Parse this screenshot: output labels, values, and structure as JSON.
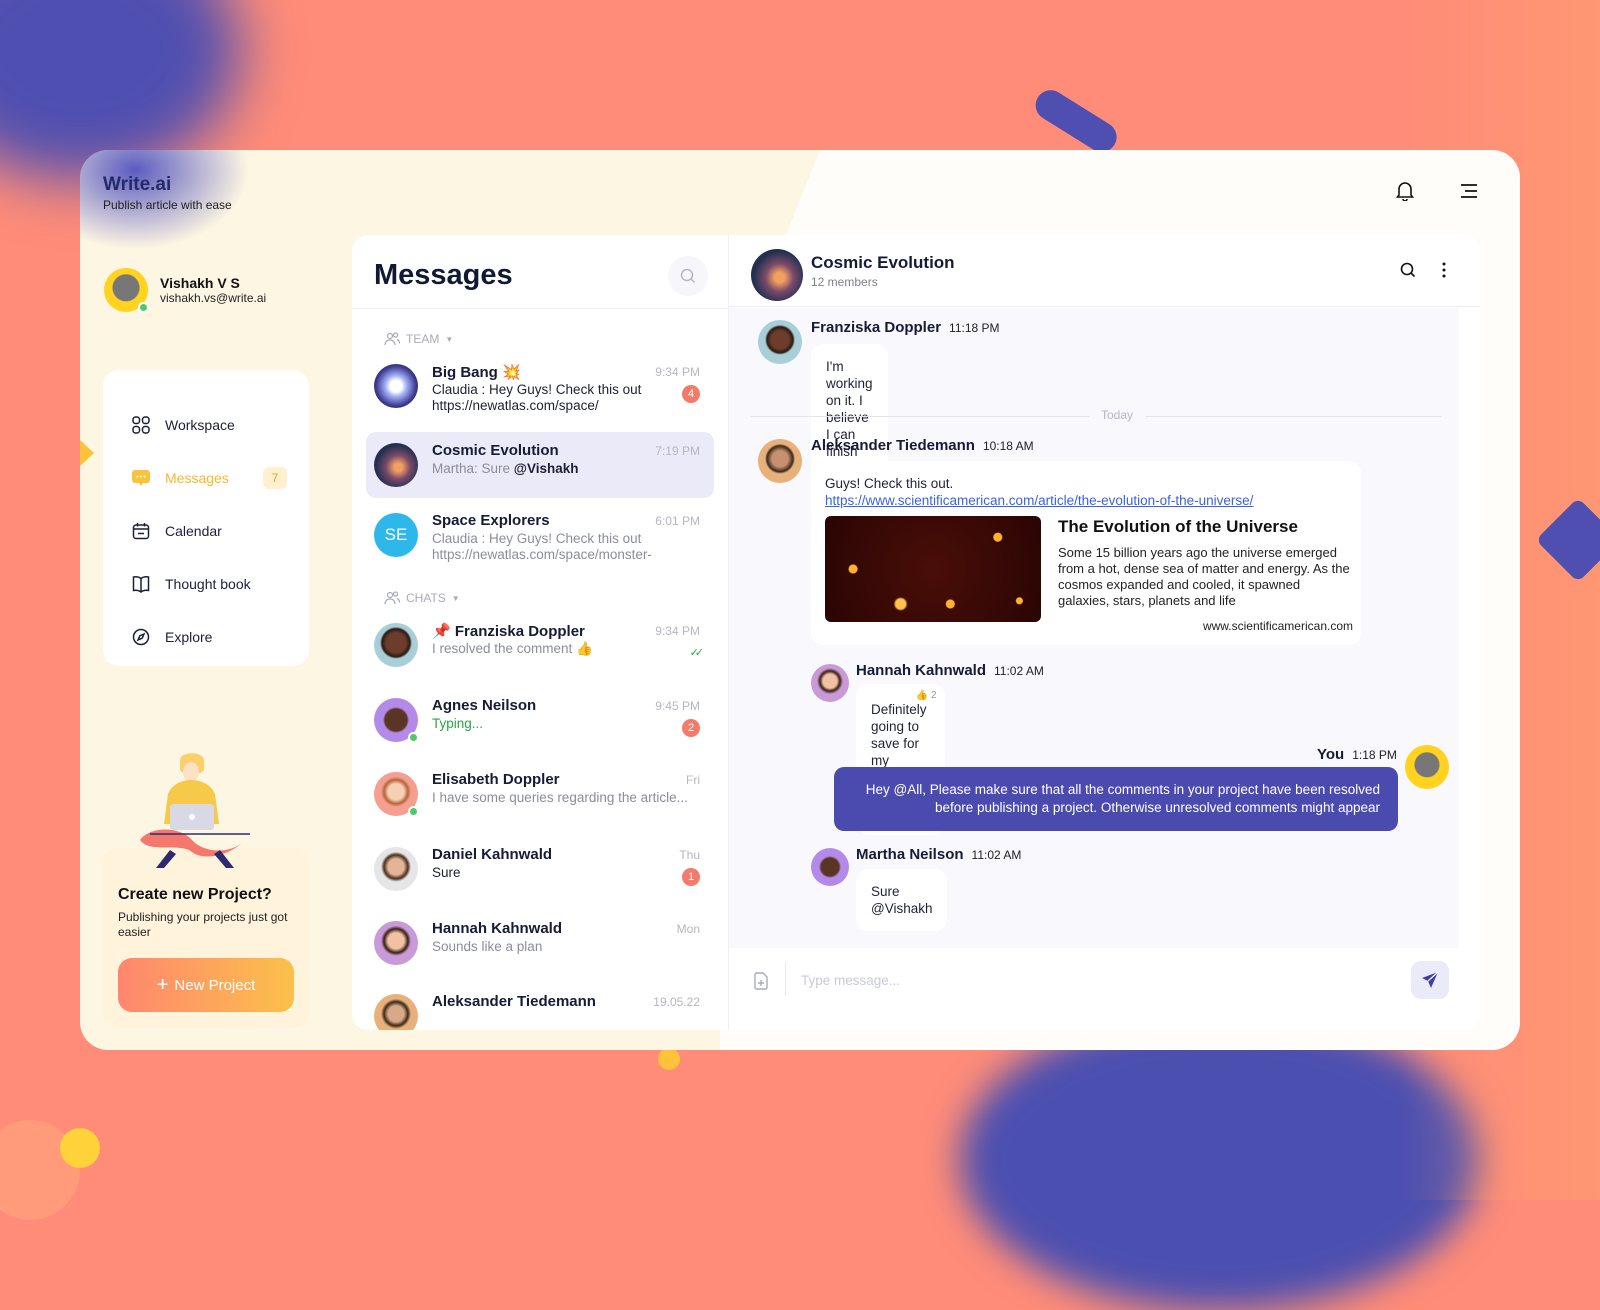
{
  "app": {
    "title": "Write.ai",
    "subtitle": "Publish article with ease"
  },
  "user": {
    "name": "Vishakh V S",
    "email": "vishakh.vs@write.ai",
    "status": "online"
  },
  "nav": {
    "items": [
      {
        "label": "Workspace",
        "icon": "grid-icon"
      },
      {
        "label": "Messages",
        "icon": "chat-bubble-icon",
        "badge": "7",
        "active": true
      },
      {
        "label": "Calendar",
        "icon": "calendar-icon"
      },
      {
        "label": "Thought book",
        "icon": "book-icon"
      },
      {
        "label": "Explore",
        "icon": "compass-icon"
      }
    ]
  },
  "promo": {
    "title": "Create new Project?",
    "text": "Publishing your projects just got easier",
    "button": "New Project"
  },
  "messages_panel": {
    "title": "Messages",
    "team_label": "TEAM",
    "chats_label": "CHATS",
    "team": [
      {
        "name": "Big Bang 💥",
        "preview": "Claudia : Hey Guys! Check this out https://newatlas.com/space/",
        "time": "9:34 PM",
        "unread": "4"
      },
      {
        "name": "Cosmic Evolution",
        "preview_prefix": "Martha: Sure ",
        "preview_mention": "@Vishakh",
        "time": "7:19 PM",
        "selected": true
      },
      {
        "name": "Space Explorers",
        "initials": "SE",
        "preview": "Claudia : Hey Guys! Check this out https://newatlas.com/space/monster-",
        "time": "6:01 PM"
      }
    ],
    "chats": [
      {
        "name": "Franziska Doppler",
        "pinned": true,
        "preview": "I resolved the comment 👍",
        "time": "9:34 PM",
        "read": true
      },
      {
        "name": "Agnes Neilson",
        "preview": "Typing...",
        "time": "9:45 PM",
        "unread": "2",
        "online": true
      },
      {
        "name": "Elisabeth Doppler",
        "preview": "I have some queries regarding the article...",
        "time": "Fri",
        "online": true
      },
      {
        "name": "Daniel Kahnwald",
        "preview": "Sure",
        "time": "Thu",
        "unread": "1"
      },
      {
        "name": "Hannah Kahnwald",
        "preview": "Sounds like a plan",
        "time": "Mon"
      },
      {
        "name": "Aleksander Tiedemann",
        "preview": "",
        "time": "19.05.22"
      }
    ]
  },
  "chat": {
    "name": "Cosmic Evolution",
    "members": "12 members",
    "divider": "Today",
    "messages": [
      {
        "author": "Franziska Doppler",
        "time": "11:18 PM",
        "text": "I'm working on it. I believe I can finish the review by next week"
      },
      {
        "author": "Aleksander Tiedemann",
        "time": "10:18 AM",
        "text": "Guys! Check this out.",
        "link": "https://www.scientificamerican.com/article/the-evolution-of-the-universe/",
        "preview": {
          "title": "The Evolution of the Universe",
          "description": "Some 15 billion years ago the universe emerged from a hot, dense sea of matter and energy. As the cosmos expanded and cooled, it spawned galaxies, stars, planets and life",
          "domain": "www.scientificamerican.com"
        }
      },
      {
        "author": "Hannah Kahnwald",
        "time": "11:02 AM",
        "text": "Definitely going to save for my upcoming project. Thanks",
        "reaction": "👍",
        "reaction_count": "2"
      },
      {
        "author": "You",
        "time": "1:18 PM",
        "text": "Hey @All, Please make sure that all the comments in your project have been resolved before publishing a project. Otherwise unresolved comments might appear"
      },
      {
        "author": "Martha Neilson",
        "time": "11:02 AM",
        "text": "Sure @Vishakh"
      }
    ],
    "input_placeholder": "Type message..."
  },
  "colors": {
    "accent": "#4b4baf",
    "nav_active": "#f6b82a",
    "unread": "#f47a6a",
    "background": "#ff8c78"
  }
}
